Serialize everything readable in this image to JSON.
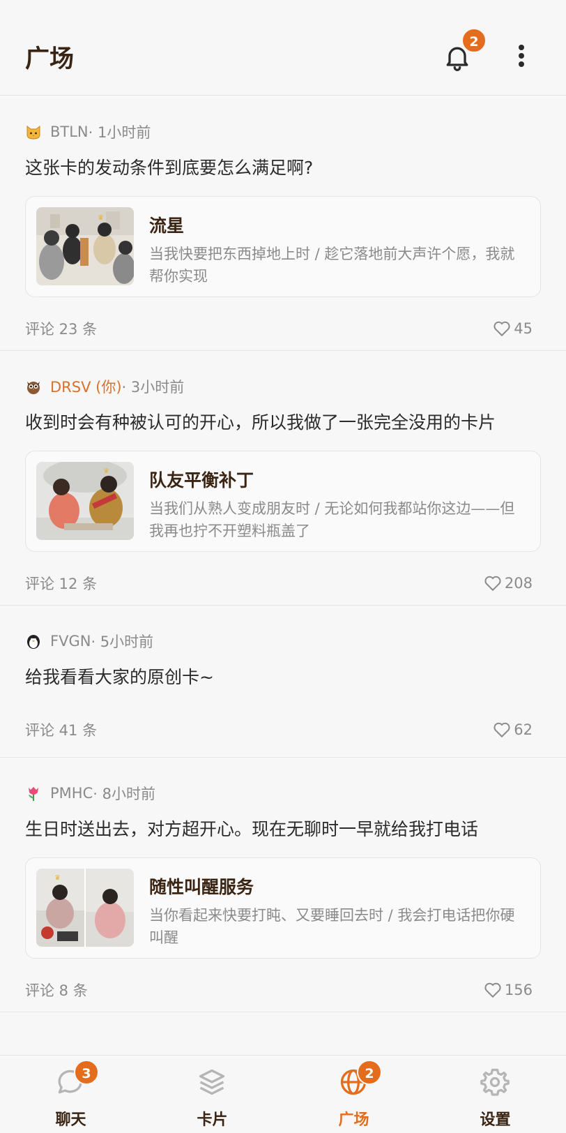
{
  "header": {
    "title": "广场",
    "notifications_count": "2",
    "bell_icon": "bell-icon",
    "more_icon": "more-vertical-icon"
  },
  "posts": [
    {
      "avatar_icon": "cat-emoji-icon",
      "author": "BTLN",
      "time": " · 1小时前",
      "is_me": false,
      "text": "这张卡的发动条件到底要怎么满足啊?",
      "card": {
        "title": "流星",
        "desc": "当我快要把东西掉地上时 / 趁它落地前大声许个愿，我就帮你实现"
      },
      "comments": "评论 23 条",
      "likes": "45"
    },
    {
      "avatar_icon": "owl-emoji-icon",
      "author": "DRSV (你)",
      "time": " · 3小时前",
      "is_me": true,
      "text": "收到时会有种被认可的开心，所以我做了一张完全没用的卡片",
      "card": {
        "title": "队友平衡补丁",
        "desc": "当我们从熟人变成朋友时 / 无论如何我都站你这边——但我再也拧不开塑料瓶盖了"
      },
      "comments": "评论 12 条",
      "likes": "208"
    },
    {
      "avatar_icon": "penguin-emoji-icon",
      "author": "FVGN",
      "time": " · 5小时前",
      "is_me": false,
      "text": "给我看看大家的原创卡~",
      "comments": "评论 41 条",
      "likes": "62"
    },
    {
      "avatar_icon": "tulip-emoji-icon",
      "author": "PMHC",
      "time": " · 8小时前",
      "is_me": false,
      "text": "生日时送出去，对方超开心。现在无聊时一早就给我打电话",
      "card": {
        "title": "随性叫醒服务",
        "desc": "当你看起来快要打盹、又要睡回去时 / 我会打电话把你硬叫醒"
      },
      "comments": "评论 8 条",
      "likes": "156"
    }
  ],
  "nav": {
    "items": [
      {
        "label": "聊天",
        "icon": "chat-bubble-icon",
        "badge": "3",
        "active": false
      },
      {
        "label": "卡片",
        "icon": "layers-icon",
        "badge": "",
        "active": false
      },
      {
        "label": "广场",
        "icon": "globe-icon",
        "badge": "2",
        "active": true
      },
      {
        "label": "设置",
        "icon": "gear-icon",
        "badge": "",
        "active": false
      }
    ]
  },
  "colors": {
    "accent": "#e36d1d",
    "title_brown": "#3a2414",
    "muted": "#8a8a8a"
  }
}
